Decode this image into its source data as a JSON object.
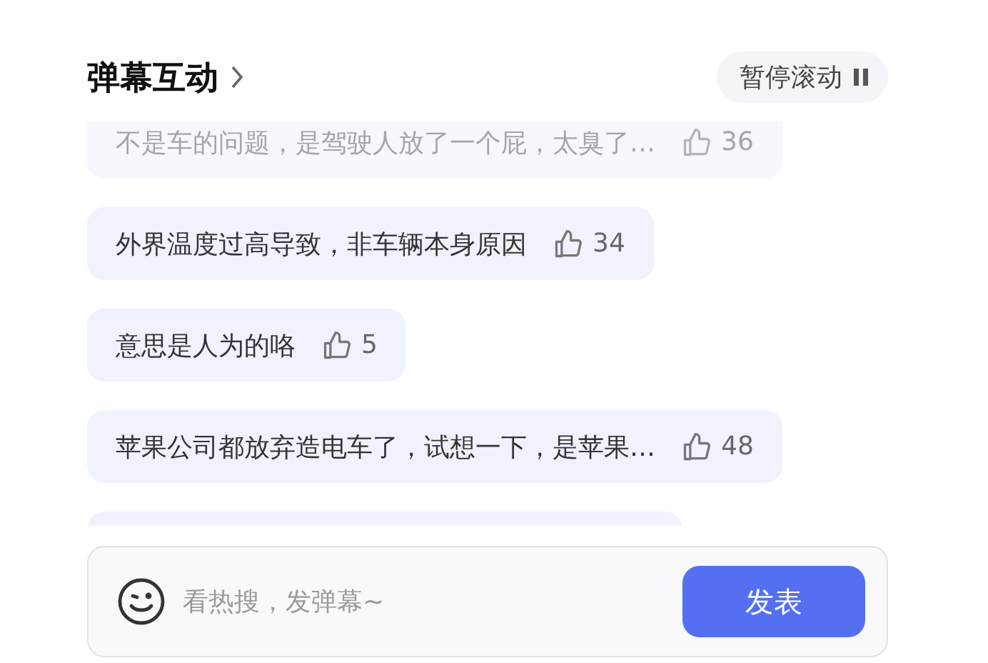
{
  "header": {
    "title": "弹幕互动",
    "pause_button": "暂停滚动"
  },
  "comments": [
    {
      "kind": "comment",
      "text": "不是车的问题，是驾驶人放了一个屁，太臭了…",
      "likes": "36",
      "faded": true
    },
    {
      "kind": "comment",
      "text": "外界温度过高导致，非车辆本身原因",
      "likes": "34",
      "faded": false
    },
    {
      "kind": "comment",
      "text": "意思是人为的咯",
      "likes": "5",
      "faded": false
    },
    {
      "kind": "comment",
      "text": "苹果公司都放弃造电车了，试想一下，是苹果…",
      "likes": "48",
      "faded": false
    },
    {
      "kind": "clipped"
    }
  ],
  "composer": {
    "placeholder": "看热搜，发弹幕~",
    "send_button": "发表"
  }
}
